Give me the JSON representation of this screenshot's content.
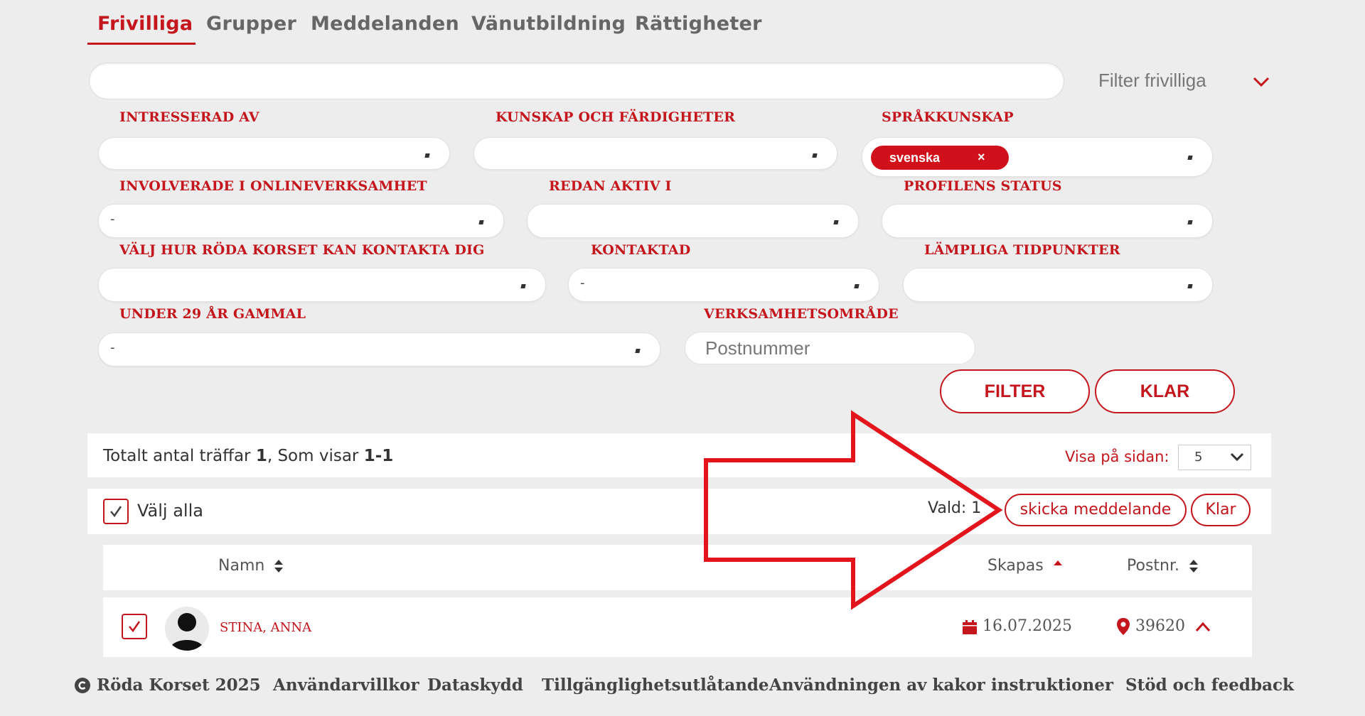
{
  "tabs": [
    {
      "label": "Frivilliga",
      "active": true
    },
    {
      "label": "Grupper",
      "active": false
    },
    {
      "label": "Meddelanden",
      "active": false
    },
    {
      "label": "Vänutbildning",
      "active": false
    },
    {
      "label": "Rättigheter",
      "active": false
    }
  ],
  "search": {
    "value": "",
    "filter_toggle_label": "Filter frivilliga"
  },
  "filters": {
    "intresserad_av": {
      "label": "INTRESSERAD AV",
      "value": ""
    },
    "kunskap": {
      "label": "KUNSKAP OCH FÄRDIGHETER",
      "value": ""
    },
    "sprakkunskap": {
      "label": "SPRÅKKUNSKAP",
      "tag": "svenska",
      "tag_remove": "×"
    },
    "involverade": {
      "label": "INVOLVERADE I ONLINEVERKSAMHET",
      "value": "-"
    },
    "redan_aktiv": {
      "label": "REDAN AKTIV I",
      "value": ""
    },
    "profilens_status": {
      "label": "PROFILENS STATUS",
      "value": ""
    },
    "kontakta": {
      "label": "VÄLJ HUR RÖDA KORSET KAN KONTAKTA DIG",
      "value": ""
    },
    "kontaktad": {
      "label": "KONTAKTAD",
      "value": "-"
    },
    "tidpunkter": {
      "label": "LÄMPLIGA TIDPUNKTER",
      "value": ""
    },
    "under29": {
      "label": "UNDER 29 ÅR GAMMAL",
      "value": "-"
    },
    "verksamhetsomrade": {
      "label": "VERKSAMHETSOMRÅDE",
      "placeholder": "Postnummer"
    }
  },
  "buttons": {
    "filter": "FILTER",
    "klar": "KLAR"
  },
  "results": {
    "prefix": "Totalt antal träffar ",
    "total": "1",
    "middle": ", Som visar ",
    "range": "1-1",
    "per_page_label": "Visa på sidan:",
    "per_page_value": "5"
  },
  "selection": {
    "select_all_label": "Välj alla",
    "selected_label": "Vald: 1",
    "send_message": "skicka meddelande",
    "clear": "Klar"
  },
  "table": {
    "headers": {
      "name": "Namn",
      "created": "Skapas",
      "postcode": "Postnr."
    },
    "rows": [
      {
        "name": "STINA, ANNA",
        "created": "16.07.2025",
        "postcode": "39620",
        "checked": true
      }
    ]
  },
  "footer": {
    "copyright": "Röda Korset 2025",
    "links": [
      "Användarvillkor",
      "Dataskydd",
      "Tillgänglighetsutlåtande",
      "Användningen av kakor",
      "instruktioner",
      "Stöd och feedback"
    ]
  },
  "colors": {
    "accent": "#c4161c",
    "background": "#ededed"
  }
}
